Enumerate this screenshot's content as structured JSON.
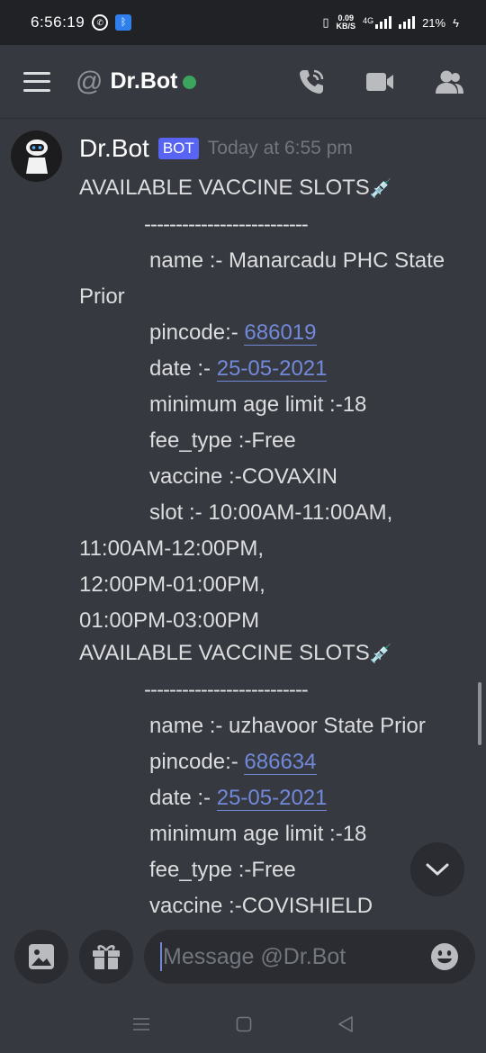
{
  "status_bar": {
    "time": "6:56:19",
    "speed_value": "0.09",
    "speed_unit": "KB/S",
    "network": "4G",
    "battery": "21%"
  },
  "header": {
    "channel_name": "Dr.Bot",
    "at_symbol": "@",
    "status_color": "#3ba55d"
  },
  "message": {
    "author": "Dr.Bot",
    "bot_tag": "BOT",
    "timestamp": "Today at 6:55 pm",
    "slot1": {
      "heading": "AVAILABLE VACCINE SLOTS",
      "separator": "--------------------------",
      "name_line1": "name :-  Manarcadu PHC State",
      "name_line2": "Prior",
      "pincode_label": "pincode:- ",
      "pincode": "686019",
      "date_label": "date :-  ",
      "date": "25-05-2021",
      "age": "minimum age limit :-18",
      "fee": "fee_type :-Free",
      "vaccine": "vaccine :-COVAXIN",
      "slot_line1": "slot :-  10:00AM-11:00AM,",
      "slot_line2": "11:00AM-12:00PM,",
      "slot_line3": "12:00PM-01:00PM,",
      "slot_line4": "01:00PM-03:00PM"
    },
    "slot2": {
      "heading": "AVAILABLE VACCINE SLOTS",
      "separator": "--------------------------",
      "name": "name :-  uzhavoor State Prior",
      "pincode_label": "pincode:- ",
      "pincode": "686634",
      "date_label": "date :-  ",
      "date": "25-05-2021",
      "age": "minimum age limit :-18",
      "fee": "fee_type :-Free",
      "vaccine": "vaccine :-COVISHIELD"
    }
  },
  "input": {
    "placeholder": "Message @Dr.Bot"
  },
  "icons": {
    "menu": "hamburger-icon",
    "call": "phone-call-icon",
    "video": "video-camera-icon",
    "members": "members-icon",
    "image": "image-icon",
    "gift": "gift-icon",
    "emoji": "emoji-icon",
    "jump": "chevron-down-icon",
    "syringe": "syringe-emoji"
  },
  "colors": {
    "background": "#36393f",
    "link": "#7289da",
    "bot_tag": "#5865f2"
  }
}
